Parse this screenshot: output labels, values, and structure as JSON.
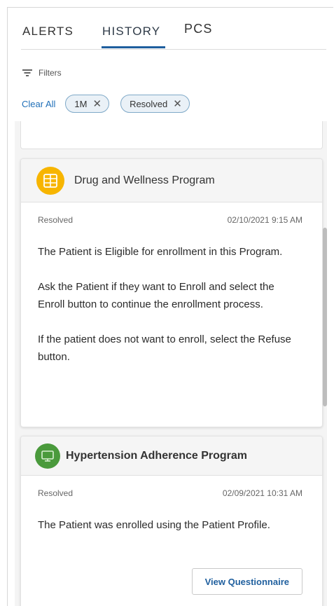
{
  "tabs": [
    {
      "label": "ALERTS"
    },
    {
      "label": "HISTORY"
    },
    {
      "label": "PCS"
    }
  ],
  "filters": {
    "label": "Filters",
    "clear_all": "Clear All",
    "chips": [
      {
        "label": "1M"
      },
      {
        "label": "Resolved"
      }
    ],
    "close_glyph": "✕"
  },
  "cards": [
    {
      "title": "Drug and Wellness Program",
      "icon": "program-grid-icon",
      "icon_color": "#f7b500",
      "status": "Resolved",
      "datetime": "02/10/2021 9:15 AM",
      "paragraphs": [
        "The Patient is Eligible for enrollment in this Program.",
        "Ask the Patient if they want to Enroll and select the Enroll button to continue the enrollment process.",
        "If the patient does not want to enroll, select the Refuse button."
      ]
    },
    {
      "title": "Hypertension Adherence Program",
      "icon": "monitor-icon",
      "icon_color": "#4a9a3c",
      "status": "Resolved",
      "datetime": "02/09/2021 10:31 AM",
      "paragraphs": [
        "The Patient was enrolled using the Patient Profile."
      ],
      "button": "View Questionnaire"
    }
  ],
  "colors": {
    "accent": "#1f5f9e",
    "link": "#1f6fb8",
    "chip_border": "#7fa9c8"
  }
}
